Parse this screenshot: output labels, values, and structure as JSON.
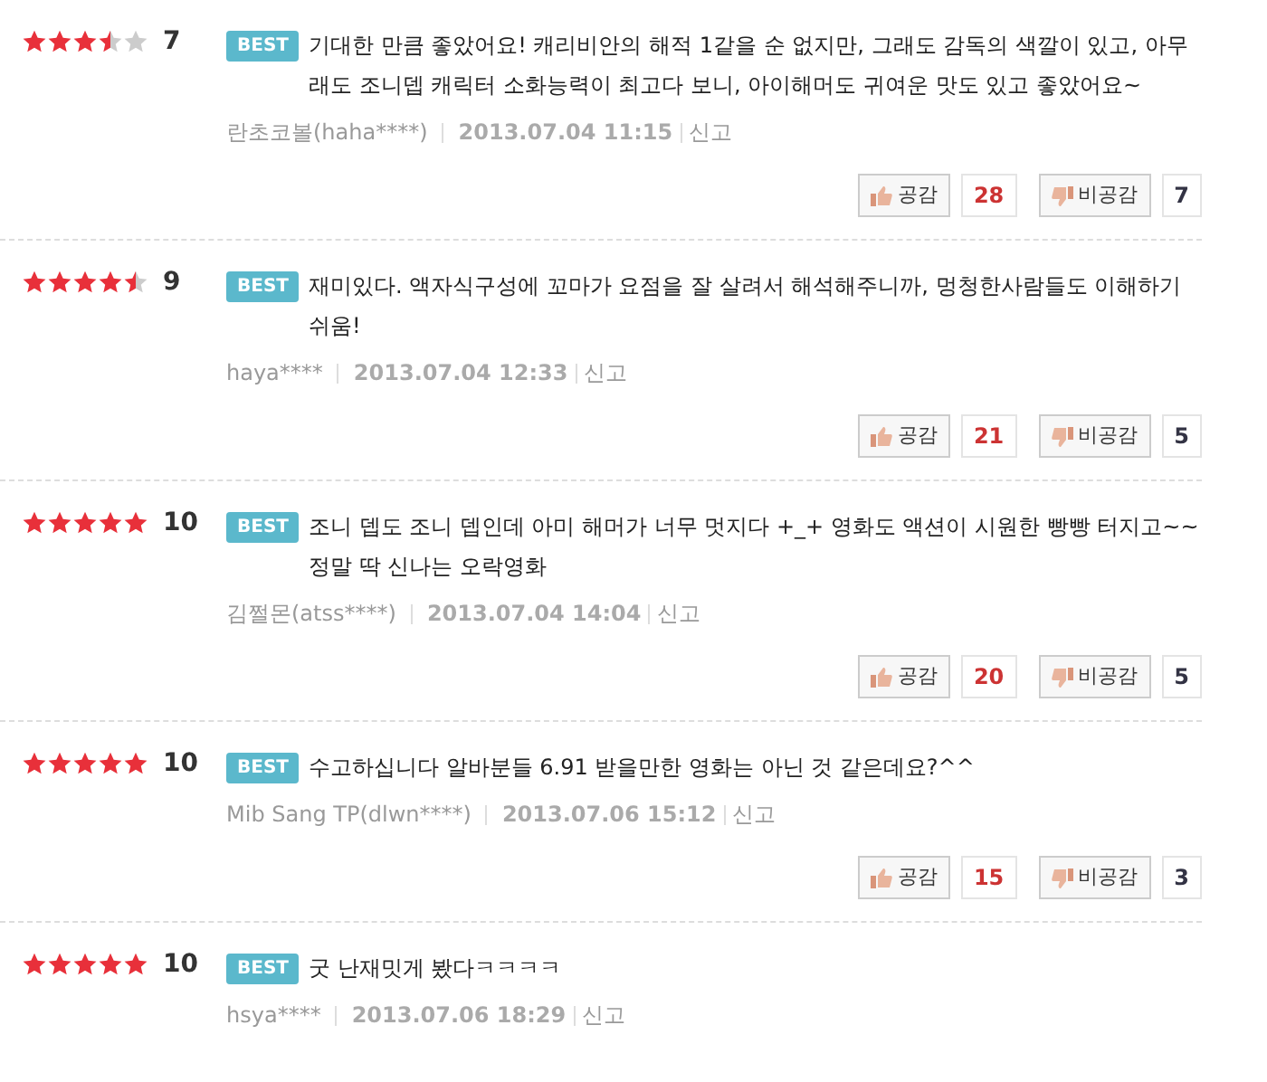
{
  "reviews": [
    {
      "stars": 3.5,
      "score": "7",
      "badge": "BEST",
      "text": "기대한 만큼 좋았어요! 캐리비안의 해적 1같을 순 없지만, 그래도 감독의 색깔이 있고, 아무래도 조니뎁 캐릭터 소화능력이 최고다 보니, 아이해머도 귀여운 맛도 있고 좋았어요~",
      "author": "란초코볼(haha****)",
      "date": "2013.07.04 11:15",
      "report": "신고",
      "like_label": "공감",
      "likes": "28",
      "dislike_label": "비공감",
      "dislikes": "7"
    },
    {
      "stars": 4.5,
      "score": "9",
      "badge": "BEST",
      "text": "재미있다. 액자식구성에 꼬마가 요점을 잘 살려서 해석해주니까, 멍청한사람들도 이해하기 쉬움!",
      "author": "haya****",
      "date": "2013.07.04 12:33",
      "report": "신고",
      "like_label": "공감",
      "likes": "21",
      "dislike_label": "비공감",
      "dislikes": "5"
    },
    {
      "stars": 5,
      "score": "10",
      "badge": "BEST",
      "text": "조니 뎁도 조니 뎁인데 아미 해머가 너무 멋지다 +_+ 영화도 액션이 시원한 빵빵 터지고~~ 정말 딱 신나는 오락영화",
      "author": "김쩔몬(atss****)",
      "date": "2013.07.04 14:04",
      "report": "신고",
      "like_label": "공감",
      "likes": "20",
      "dislike_label": "비공감",
      "dislikes": "5"
    },
    {
      "stars": 5,
      "score": "10",
      "badge": "BEST",
      "text": "수고하십니다 알바분들 6.91 받을만한 영화는 아닌 것 같은데요?^^",
      "author": "Mib Sang TP(dlwn****)",
      "date": "2013.07.06 15:12",
      "report": "신고",
      "like_label": "공감",
      "likes": "15",
      "dislike_label": "비공감",
      "dislikes": "3"
    },
    {
      "stars": 5,
      "score": "10",
      "badge": "BEST",
      "text": "굿 난재밋게 봤다ㅋㅋㅋㅋ",
      "author": "hsya****",
      "date": "2013.07.06 18:29",
      "report": "신고"
    }
  ]
}
